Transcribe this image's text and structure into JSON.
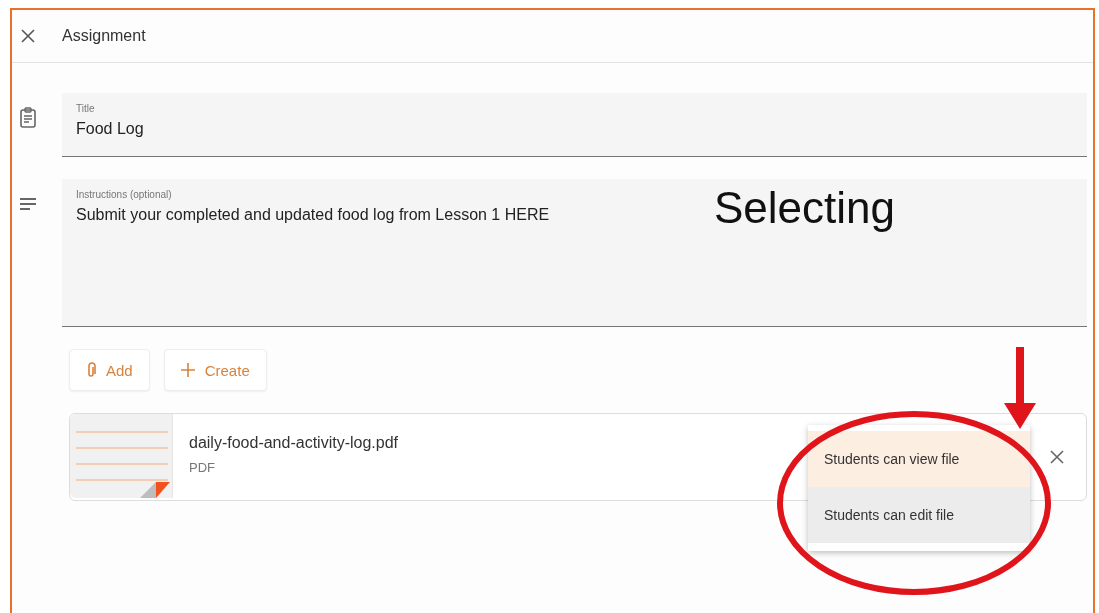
{
  "header": {
    "title": "Assignment"
  },
  "title_field": {
    "label": "Title",
    "value": "Food Log"
  },
  "instructions_field": {
    "label": "Instructions (optional)",
    "value": "Submit your completed and updated food log from Lesson 1 HERE"
  },
  "annotation": {
    "text": "Selecting"
  },
  "buttons": [
    {
      "kind": "add",
      "label": "Add"
    },
    {
      "kind": "create",
      "label": "Create"
    }
  ],
  "attachment": {
    "name": "daily-food-and-activity-log.pdf",
    "type": "PDF"
  },
  "menu": [
    {
      "label": "Students can view file",
      "selected": true
    },
    {
      "label": "Students can edit file",
      "selected": false
    }
  ]
}
